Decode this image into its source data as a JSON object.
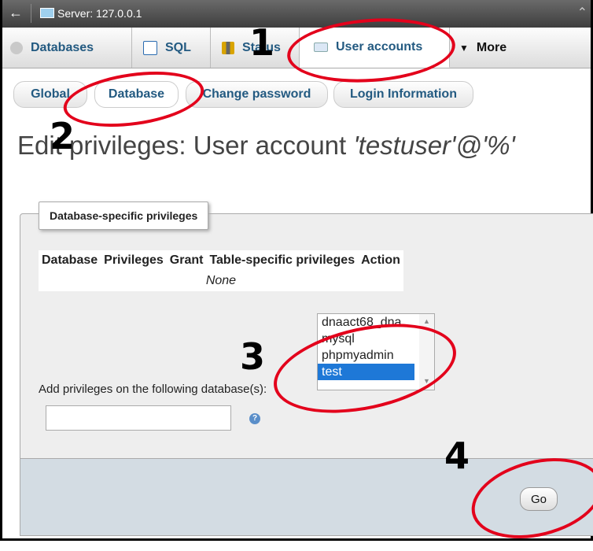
{
  "topbar": {
    "back": "←",
    "server": "Server: 127.0.0.1",
    "collapse": "⌃"
  },
  "tabs": [
    {
      "label": "Databases"
    },
    {
      "label": "SQL"
    },
    {
      "label": "Status"
    },
    {
      "label": "User accounts"
    },
    {
      "label": "More"
    }
  ],
  "subtabs": [
    {
      "label": "Global"
    },
    {
      "label": "Database"
    },
    {
      "label": "Change password"
    },
    {
      "label": "Login Information"
    }
  ],
  "title": {
    "prefix": "Edit privileges: User account ",
    "account": "'testuser'@'%'"
  },
  "fieldset": {
    "legend": "Database-specific privileges",
    "table": {
      "headers": [
        "Database",
        "Privileges",
        "Grant",
        "Table-specific privileges",
        "Action"
      ],
      "empty": "None"
    },
    "add_label": "Add privileges on the following database(s):",
    "db_options": [
      "dnaact68_dna",
      "mysql",
      "phpmyadmin",
      "test"
    ],
    "selected": "test",
    "go": "Go"
  },
  "annotations": {
    "n1": "1",
    "n2": "2",
    "n3": "3",
    "n4": "4"
  },
  "colors": {
    "highlight": "#e3001b",
    "link": "#235a81",
    "selection": "#1e78d7"
  }
}
